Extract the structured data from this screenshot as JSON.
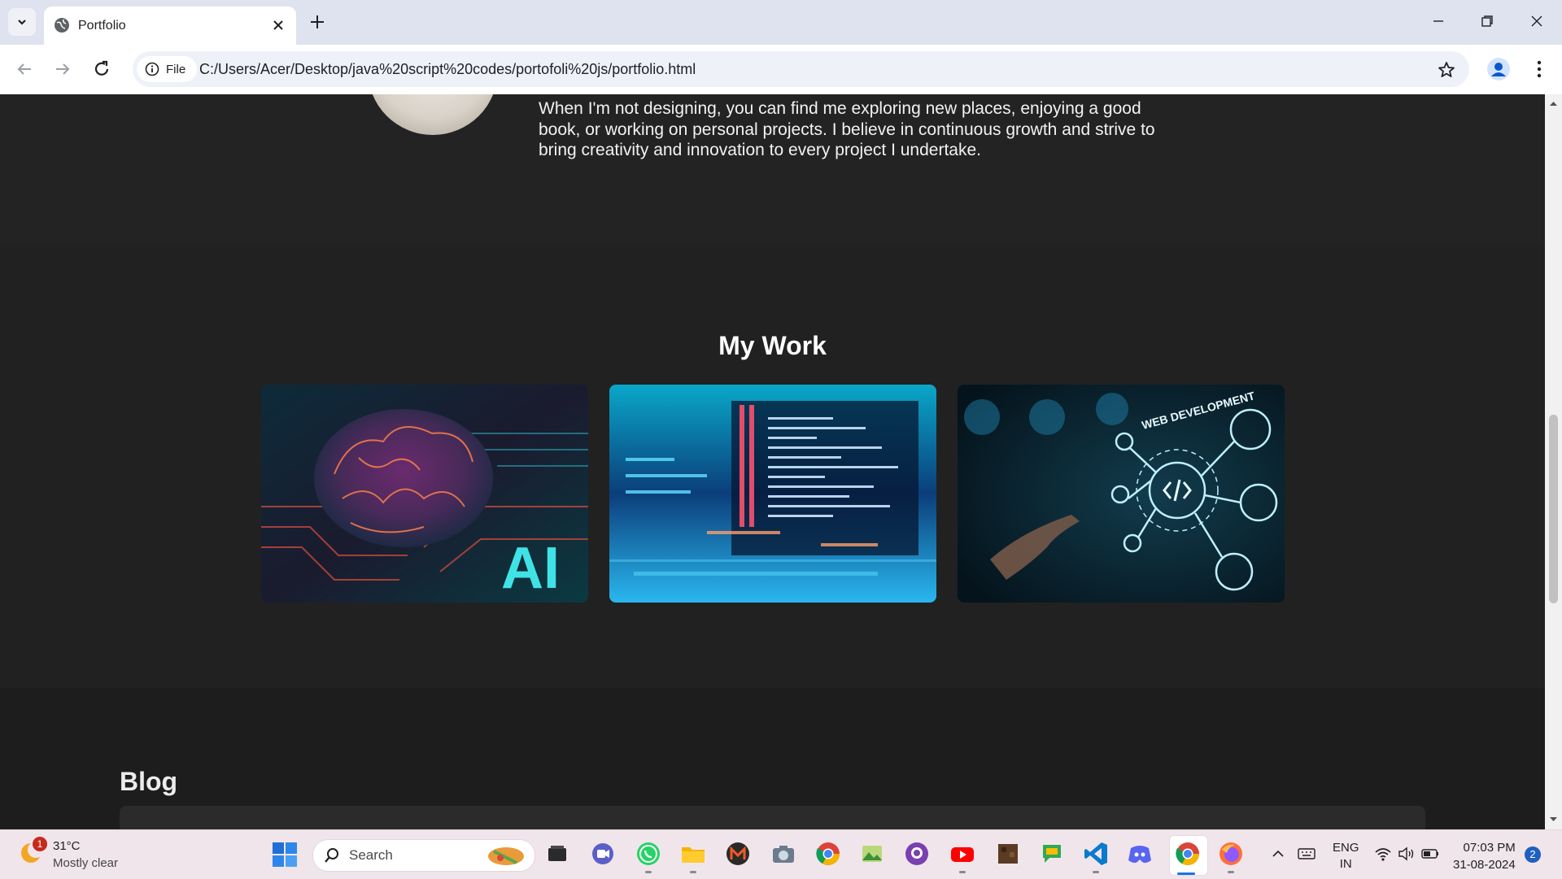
{
  "browser": {
    "tab_title": "Portfolio",
    "chip_label": "File",
    "url": "C:/Users/Acer/Desktop/java%20script%20codes/portofoli%20js/portfolio.html"
  },
  "page": {
    "about": {
      "text": "When I'm not designing, you can find me exploring new places, enjoying a good book, or working on personal projects. I believe in continuous growth and strive to bring creativity and innovation to every project I undertake."
    },
    "work": {
      "title": "My Work",
      "cards": [
        {
          "image": "ai-brain-circuit",
          "overlay_text": "AI"
        },
        {
          "image": "code-screen"
        },
        {
          "image": "web-development",
          "overlay_text": "WEB DEVELOPMENT"
        }
      ]
    },
    "blog": {
      "title": "Blog"
    }
  },
  "taskbar": {
    "weather": {
      "temp": "31°C",
      "condition": "Mostly clear",
      "badge": "1"
    },
    "search_label": "Search",
    "language": {
      "line1": "ENG",
      "line2": "IN"
    },
    "clock": {
      "time": "07:03 PM",
      "date": "31-08-2024"
    },
    "notification_count": "2",
    "apps": [
      "file-explorer-dark",
      "meet-now",
      "whatsapp",
      "file-explorer",
      "m-app",
      "camera",
      "chrome",
      "image-viewer",
      "github-desktop",
      "youtube",
      "minecraft",
      "google-chat",
      "vscode",
      "discord",
      "chrome-active",
      "firefox"
    ]
  }
}
